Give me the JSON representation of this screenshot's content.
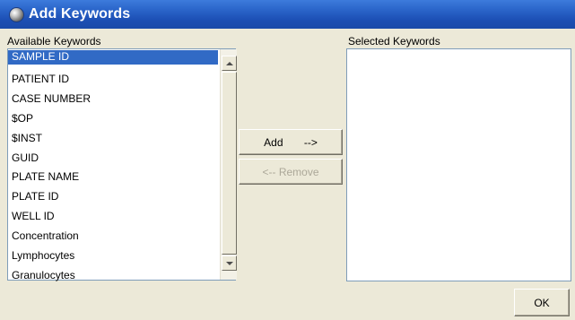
{
  "window": {
    "title": "Add Keywords"
  },
  "available": {
    "label": "Available Keywords",
    "items": [
      {
        "label": "SAMPLE ID",
        "selected": true
      },
      {
        "label": "PATIENT ID"
      },
      {
        "label": "CASE NUMBER"
      },
      {
        "label": "$OP"
      },
      {
        "label": "$INST"
      },
      {
        "label": "GUID"
      },
      {
        "label": "PLATE NAME"
      },
      {
        "label": "PLATE ID"
      },
      {
        "label": "WELL ID"
      },
      {
        "label": "Concentration"
      },
      {
        "label": "Lymphocytes"
      },
      {
        "label": "Granulocytes"
      }
    ]
  },
  "selected": {
    "label": "Selected Keywords",
    "items": []
  },
  "buttons": {
    "add_label": "Add       -->",
    "remove_label": "<-- Remove",
    "ok_label": "OK"
  },
  "colors": {
    "selection": "#316ac5",
    "titlebar": "#2a64c9",
    "dialog_bg": "#ece9d8"
  }
}
